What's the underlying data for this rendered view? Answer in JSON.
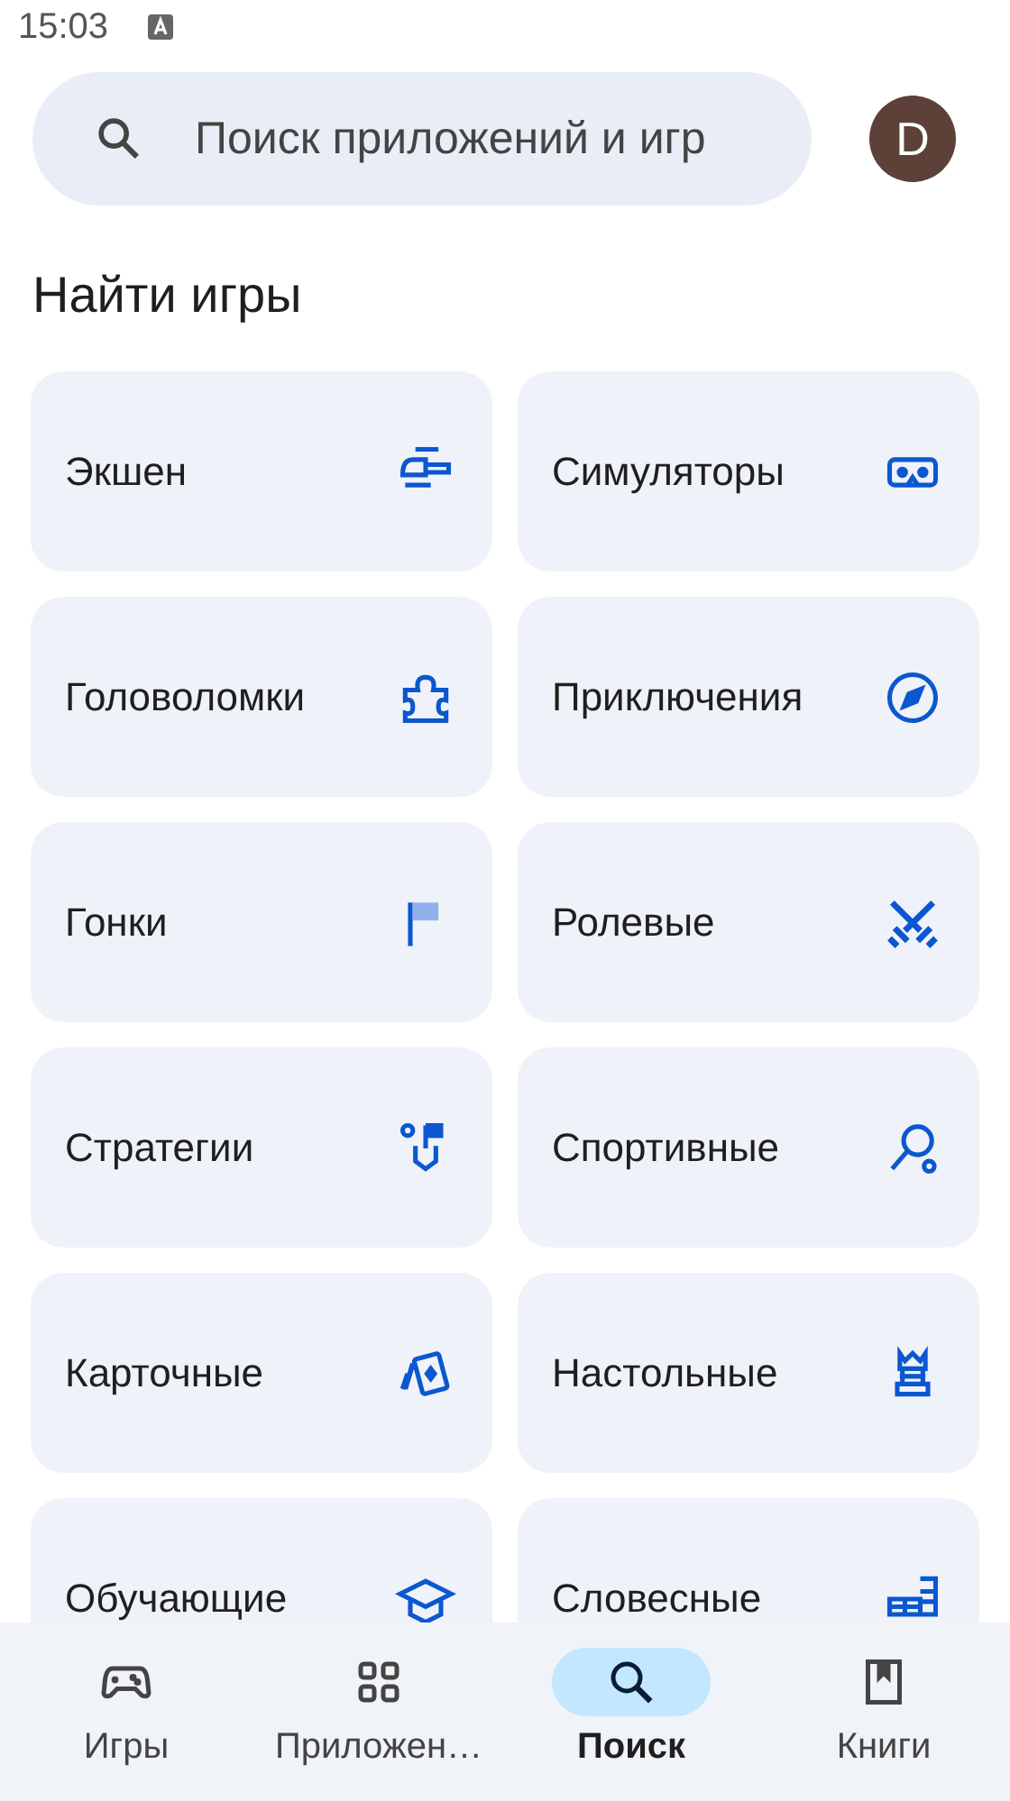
{
  "status_bar": {
    "time": "15:03"
  },
  "search": {
    "placeholder": "Поиск приложений и игр"
  },
  "account": {
    "initial": "D"
  },
  "section": {
    "title": "Найти игры"
  },
  "categories": [
    {
      "label": "Экшен"
    },
    {
      "label": "Симуляторы"
    },
    {
      "label": "Головоломки"
    },
    {
      "label": "Приключения"
    },
    {
      "label": "Гонки"
    },
    {
      "label": "Ролевые"
    },
    {
      "label": "Стратегии"
    },
    {
      "label": "Спортивные"
    },
    {
      "label": "Карточные"
    },
    {
      "label": "Настольные"
    },
    {
      "label": "Обучающие"
    },
    {
      "label": "Словесные"
    }
  ],
  "bottom_nav": [
    {
      "label": "Игры",
      "selected": false
    },
    {
      "label": "Приложен…",
      "selected": false
    },
    {
      "label": "Поиск",
      "selected": true
    },
    {
      "label": "Книги",
      "selected": false
    }
  ]
}
